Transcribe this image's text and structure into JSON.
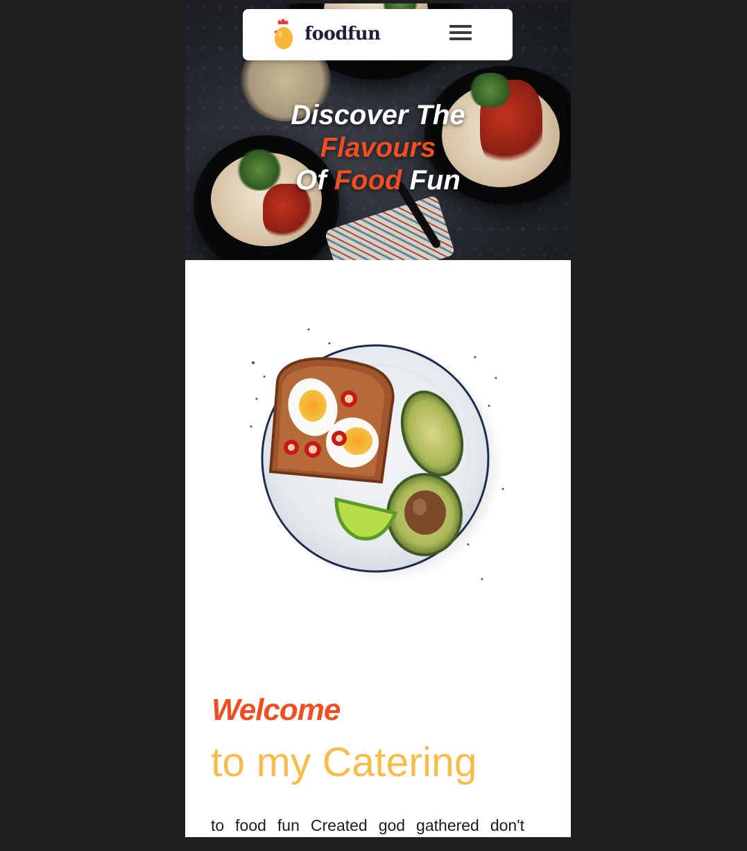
{
  "nav": {
    "brand": "foodfun",
    "logo_icon": "egg-with-comb-icon",
    "menu_icon": "hamburger-menu-icon"
  },
  "hero": {
    "line1": "Discover The",
    "line2": "Flavours",
    "line3_part1": "Of",
    "line3_accent": "Food",
    "line3_part2": "Fun"
  },
  "welcome": {
    "title": "Welcome",
    "subtitle": "to my Catering",
    "body": "to food fun Created god gathered don't"
  },
  "colors": {
    "accent": "#f04e23",
    "secondary": "#f8bc4a",
    "brand_text": "#1c1f3a",
    "background": "#1f1f21"
  }
}
